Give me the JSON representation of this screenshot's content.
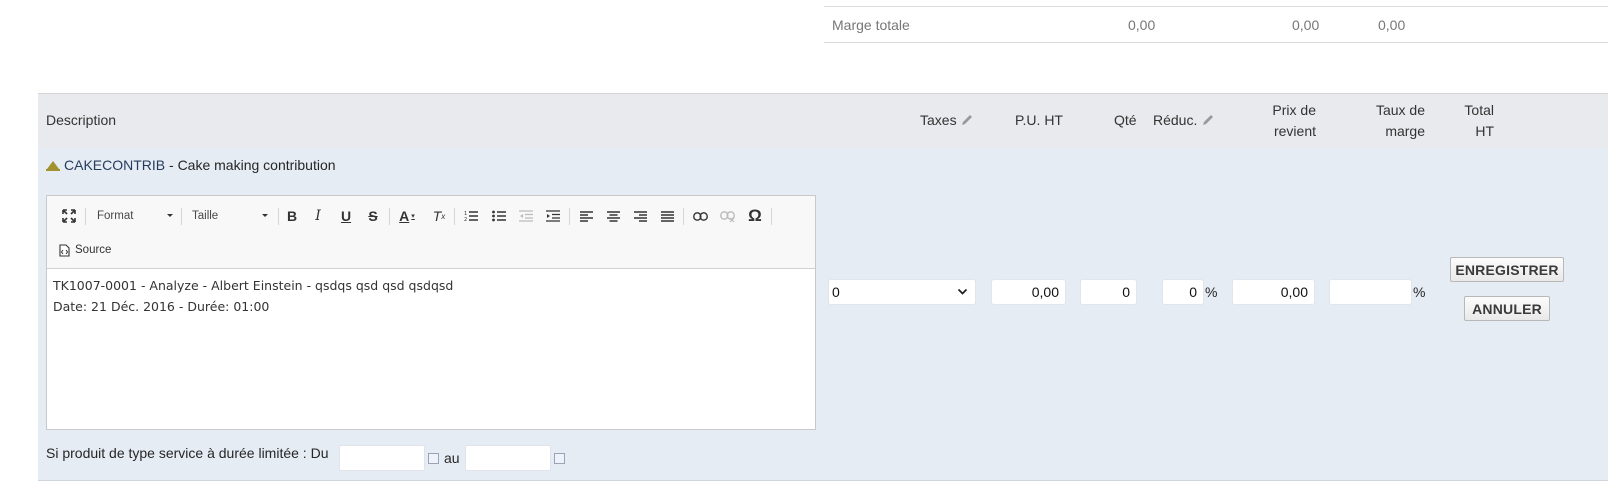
{
  "summary": {
    "label": "Marge totale",
    "v1": "0,00",
    "v2": "0,00",
    "v3": "0,00"
  },
  "header": {
    "description": "Description",
    "taxes": "Taxes",
    "pu_ht": "P.U. HT",
    "qte": "Qté",
    "reduc": "Réduc.",
    "prix_revient_1": "Prix de",
    "prix_revient_2": "revient",
    "taux_marge_1": "Taux de",
    "taux_marge_2": "marge",
    "total_1": "Total",
    "total_2": "HT"
  },
  "product": {
    "ref": "CAKECONTRIB",
    "label": " - Cake making contribution"
  },
  "editor": {
    "format_label": "Format",
    "size_label": "Taille",
    "source_label": "Source",
    "line1": "TK1007-0001 - Analyze - Albert Einstein - qsdqs qsd qsd qsdqsd",
    "line2": "Date: 21 Déc. 2016 - Durée: 01:00"
  },
  "service": {
    "label": "Si produit de type service à durée limitée : Du",
    "au": "au",
    "from_value": "",
    "to_value": ""
  },
  "fields": {
    "tax": "0",
    "pu_ht": "0,00",
    "qty": "0",
    "reduc": "0",
    "reduc_unit": "%",
    "buy_price": "0,00",
    "margin_rate": "",
    "margin_unit": "%"
  },
  "buttons": {
    "save": "ENREGISTRER",
    "cancel": "ANNULER"
  },
  "colors": {
    "header_bg": "#e9eaed",
    "edit_bg": "#e6ecf4",
    "ref_link": "#263c5c"
  }
}
